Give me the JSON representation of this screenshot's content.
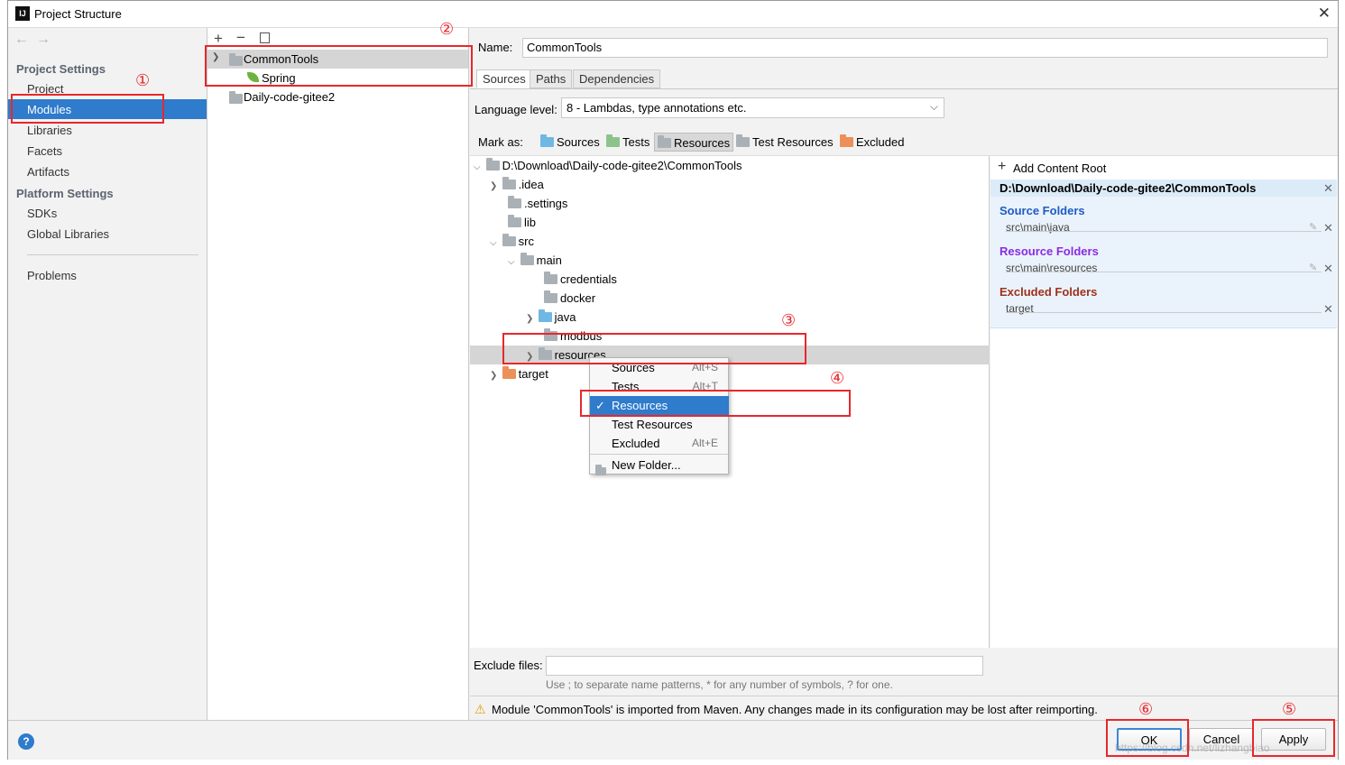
{
  "window": {
    "title": "Project Structure"
  },
  "sidebar": {
    "project_settings_heading": "Project Settings",
    "items_top": [
      {
        "label": "Project"
      },
      {
        "label": "Modules"
      },
      {
        "label": "Libraries"
      },
      {
        "label": "Facets"
      },
      {
        "label": "Artifacts"
      }
    ],
    "platform_settings_heading": "Platform Settings",
    "items_platform": [
      {
        "label": "SDKs"
      },
      {
        "label": "Global Libraries"
      }
    ],
    "problems_label": "Problems"
  },
  "modules_tree": {
    "items": [
      {
        "label": "CommonTools"
      },
      {
        "label": "Spring"
      },
      {
        "label": "Daily-code-gitee2"
      }
    ]
  },
  "module": {
    "name_label": "Name:",
    "name_value": "CommonTools",
    "tabs": [
      {
        "label": "Sources"
      },
      {
        "label": "Paths"
      },
      {
        "label": "Dependencies"
      }
    ],
    "language_level_label": "Language level:",
    "language_level_value": "8 - Lambdas, type annotations etc.",
    "mark_as_label": "Mark as:",
    "mark_as": [
      {
        "label": "Sources",
        "color": "#6fb8e4"
      },
      {
        "label": "Tests",
        "color": "#8cc38b"
      },
      {
        "label": "Resources",
        "color": "#a9b0b6"
      },
      {
        "label": "Test Resources",
        "color": "#a9b0b6"
      },
      {
        "label": "Excluded",
        "color": "#ec8f58"
      }
    ]
  },
  "file_tree": {
    "root": "D:\\Download\\Daily-code-gitee2\\CommonTools",
    "nodes": [
      {
        "label": ".idea"
      },
      {
        "label": ".settings"
      },
      {
        "label": "lib"
      },
      {
        "label": "src"
      },
      {
        "label": "main"
      },
      {
        "label": "credentials"
      },
      {
        "label": "docker"
      },
      {
        "label": "java"
      },
      {
        "label": "modbus"
      },
      {
        "label": "resources"
      },
      {
        "label": "target"
      }
    ]
  },
  "context_menu": {
    "items": [
      {
        "label": "Sources",
        "shortcut": "Alt+S"
      },
      {
        "label": "Tests",
        "shortcut": "Alt+T"
      },
      {
        "label": "Resources",
        "shortcut": ""
      },
      {
        "label": "Test Resources",
        "shortcut": ""
      },
      {
        "label": "Excluded",
        "shortcut": "Alt+E"
      },
      {
        "label": "New Folder...",
        "shortcut": ""
      }
    ]
  },
  "content_roots": {
    "add_label": "Add Content Root",
    "root_path": "D:\\Download\\Daily-code-gitee2\\CommonTools",
    "source_folders_heading": "Source Folders",
    "source_folder": "src\\main\\java",
    "resource_folders_heading": "Resource Folders",
    "resource_folder": "src\\main\\resources",
    "excluded_folders_heading": "Excluded Folders",
    "excluded_folder": "target",
    "colors": {
      "source": "#1e5bc6",
      "resource": "#8a2be2",
      "excluded": "#a0301c"
    }
  },
  "exclude": {
    "label": "Exclude files:",
    "value": "",
    "hint": "Use ; to separate name patterns, * for any number of symbols, ? for one."
  },
  "warning": "Module 'CommonTools' is imported from Maven. Any changes made in its configuration may be lost after reimporting.",
  "buttons": {
    "ok": "OK",
    "cancel": "Cancel",
    "apply": "Apply"
  },
  "annotations": [
    "①",
    "②",
    "③",
    "④",
    "⑤",
    "⑥"
  ],
  "watermark": "https://blog.csdn.net/lizhangbiao"
}
